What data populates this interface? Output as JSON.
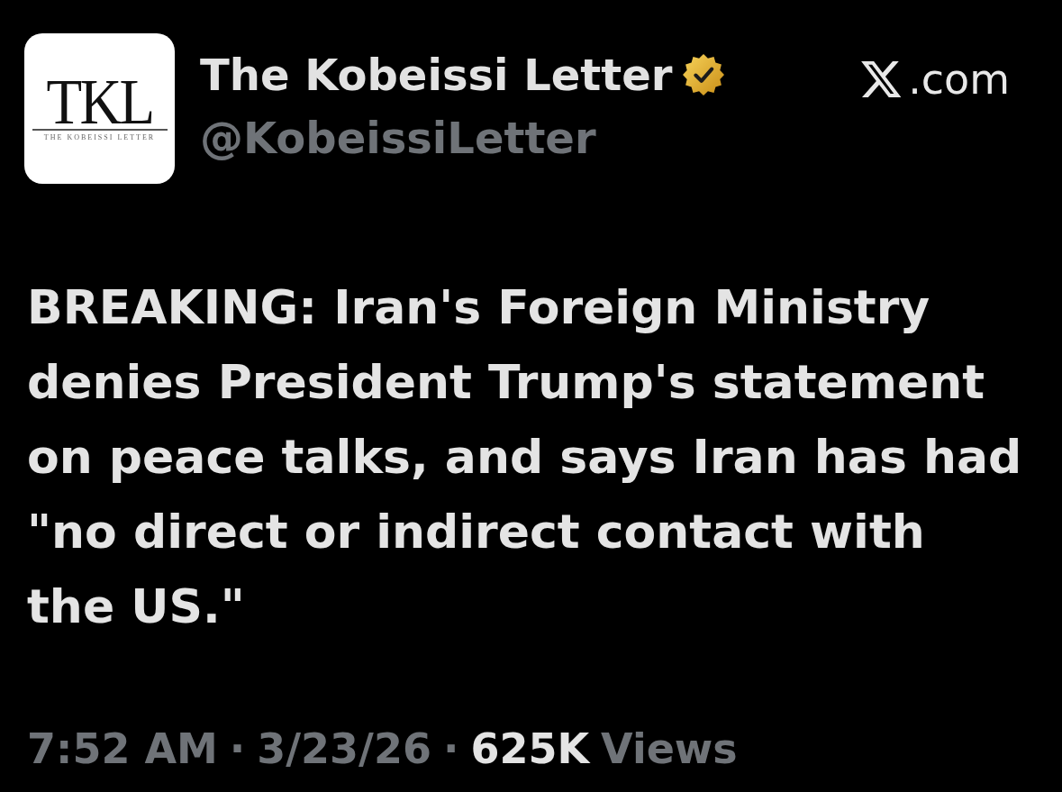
{
  "account": {
    "logo": {
      "monogram": "TKL",
      "wordmark": "THE KOBEISSI LETTER"
    },
    "name": "The Kobeissi Letter",
    "verified": true,
    "handle": "@KobeissiLetter"
  },
  "source": {
    "label": ".com"
  },
  "post": {
    "text": "BREAKING: Iran's Foreign Ministry denies President Trump's statement on peace talks, and says Iran has had \"no direct or indirect contact with the US.\""
  },
  "meta": [
    {
      "kind": "time",
      "text": "7:52 AM"
    },
    {
      "kind": "separator",
      "text": "·"
    },
    {
      "kind": "date",
      "text": "3/23/26"
    },
    {
      "kind": "separator",
      "text": "·"
    },
    {
      "kind": "count",
      "text": "625K"
    },
    {
      "kind": "label",
      "text": "Views"
    }
  ]
}
